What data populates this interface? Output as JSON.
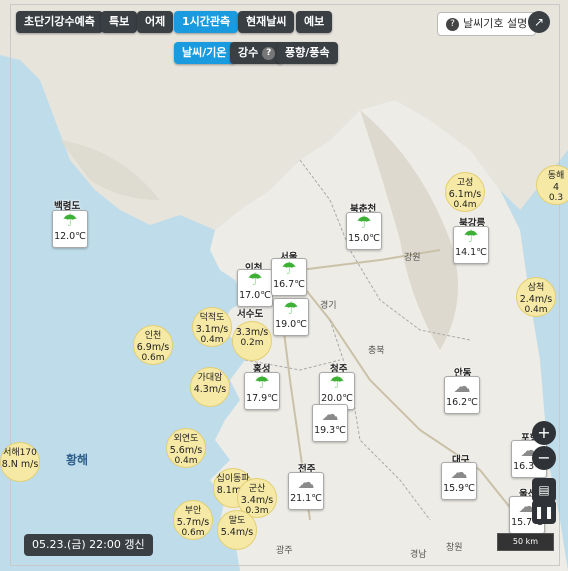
{
  "top_tabs": [
    {
      "label": "초단기강수예측",
      "active": false
    },
    {
      "label": "특보",
      "active": false
    },
    {
      "label": "어제",
      "active": false
    },
    {
      "label": "1시간관측",
      "active": true
    },
    {
      "label": "현재날씨",
      "active": false
    },
    {
      "label": "예보",
      "active": false
    }
  ],
  "sub_tabs": [
    {
      "label": "날씨/기온",
      "active": true
    },
    {
      "label": "강수",
      "active": false,
      "help": "?"
    },
    {
      "label": "풍향/풍속",
      "active": false
    }
  ],
  "legend_button": {
    "icon": "?",
    "label": "날씨기호 설명"
  },
  "external_icon": "open-external-icon",
  "stations": [
    {
      "name": "백령도",
      "temp": "12.0℃",
      "icon": "umbrella-rain"
    },
    {
      "name": "북춘천",
      "temp": "15.0℃",
      "icon": "umbrella-rain"
    },
    {
      "name": "북강릉",
      "temp": "14.1℃",
      "icon": "umbrella-rain"
    },
    {
      "name": "인천",
      "temp": "17.0℃",
      "icon": "umbrella-rain"
    },
    {
      "name": "서울",
      "temp": "16.7℃",
      "icon": "umbrella-rain"
    },
    {
      "name": "서수도",
      "temp": "19.0℃",
      "icon": "umbrella-rain"
    },
    {
      "name": "홍성",
      "temp": "17.9℃",
      "icon": "umbrella-rain"
    },
    {
      "name": "청주",
      "temp": "20.0℃",
      "icon": "umbrella-rain"
    },
    {
      "name": "",
      "temp": "19.3℃",
      "icon": "cloud"
    },
    {
      "name": "안동",
      "temp": "16.2℃",
      "icon": "cloud"
    },
    {
      "name": "전주",
      "temp": "21.1℃",
      "icon": "cloud"
    },
    {
      "name": "대구",
      "temp": "15.9℃",
      "icon": "cloud"
    },
    {
      "name": "포항",
      "temp": "16.3℃",
      "icon": "cloud"
    },
    {
      "name": "울산",
      "temp": "15.7℃",
      "icon": "cloud"
    }
  ],
  "wind_buoys": [
    {
      "name": "동해",
      "speed": "4",
      "height": "0.3"
    },
    {
      "name": "고성",
      "speed": "6.1m/s",
      "height": "0.4m"
    },
    {
      "name": "삼척",
      "speed": "2.4m/s",
      "height": "0.4m"
    },
    {
      "name": "덕적도",
      "speed": "3.1m/s",
      "height": "0.4m"
    },
    {
      "name": "인천",
      "speed": "6.9m/s",
      "height": "0.6m"
    },
    {
      "name": "",
      "speed": "3.3m/s",
      "height": "0.2m"
    },
    {
      "name": "가대암",
      "speed": "4.3m/s",
      "height": ""
    },
    {
      "name": "외연도",
      "speed": "5.6m/s",
      "height": "0.4m"
    },
    {
      "name": "서해170",
      "speed": "8.N m/s",
      "height": ""
    },
    {
      "name": "십이동파",
      "speed": "8.1m/s",
      "height": ""
    },
    {
      "name": "군산",
      "speed": "3.4m/s",
      "height": "0.3m"
    },
    {
      "name": "부안",
      "speed": "5.7m/s",
      "height": "0.6m"
    },
    {
      "name": "말도",
      "speed": "5.4m/s",
      "height": ""
    }
  ],
  "map_labels": {
    "sea": "황해",
    "places": [
      "강원",
      "경기",
      "충북",
      "경남",
      "광주",
      "창원"
    ]
  },
  "update_time": "05.23.(금) 22:00 갱신",
  "scale_label": "50 km",
  "zoom_in": "+",
  "zoom_out": "−",
  "colors": {
    "active_tab": "#1a9be0",
    "dark_tab": "#3a3f44",
    "sea": "#bfdcea",
    "land": "#eeece6",
    "rain_icon": "#3db035",
    "wind_bubble": "#f6e9a6"
  }
}
